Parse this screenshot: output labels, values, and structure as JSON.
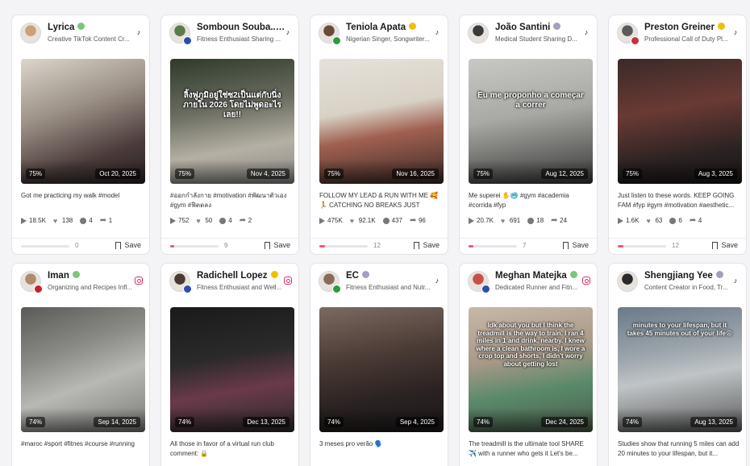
{
  "cards": [
    {
      "name": "Lyrica",
      "bio": "Creative TikTok Content Cr...",
      "platform": "tiktok",
      "score": "75%",
      "date": "Oct 20, 2025",
      "caption": "Got me practicing my walk #model",
      "views": "18.5K",
      "likes": "138",
      "comments": "4",
      "shares": "1",
      "count": "0",
      "save": "Save",
      "progress": 0,
      "overlay": "",
      "avatar_color": "#c9a27a",
      "flag_color": "",
      "badge_color": "#7bc67b",
      "thumb_bg": "linear-gradient(160deg,#dcd6cc 0%,#9a8f84 40%,#4a3a3a 75%,#2a2424 100%)"
    },
    {
      "name": "Somboun Souba...",
      "bio": "Fitness Enthusiast Sharing ...",
      "platform": "tiktok",
      "score": "75%",
      "date": "Nov 4, 2025",
      "caption": "#ออกกำลังกาย #motivation #พัฒนาตัวเอง #gym #ฟิตตลง",
      "views": "752",
      "likes": "50",
      "comments": "4",
      "shares": "2",
      "count": "9",
      "save": "Save",
      "progress": 0.08,
      "overlay": "ลิ้งฟูภูมิอยู่ใช่ซ2เป็นแต่กับนิ่ง ภายใน 2026 โดยไม่พูดอะไรเลย!!",
      "avatar_color": "#5c7a4a",
      "flag_color": "#2a4db0",
      "badge_color": "#a0a0c0",
      "thumb_bg": "linear-gradient(170deg,#2f3a2a 0%,#6a6d60 40%,#b5b0a4 70%,#8a8a88 100%)"
    },
    {
      "name": "Teniola Apata",
      "bio": "Nigerian Singer, Songwriter...",
      "platform": "tiktok",
      "score": "75%",
      "date": "Nov 16, 2025",
      "caption": "FOLLOW MY LEAD & RUN WITH ME 🥰 🏃 CATCHING NO BREAKS JUST SPEE...",
      "views": "475K",
      "likes": "92.1K",
      "comments": "437",
      "shares": "96",
      "count": "12",
      "save": "Save",
      "progress": 0.12,
      "overlay": "",
      "avatar_color": "#6a4a3a",
      "flag_color": "#2f9a3a",
      "badge_color": "#f0c000",
      "thumb_bg": "linear-gradient(170deg,#e6e2da 0%,#d8d2c6 40%,#a06050 60%,#3a2a26 100%)"
    },
    {
      "name": "João Santini",
      "bio": "Medical Student Sharing D...",
      "platform": "tiktok",
      "score": "75%",
      "date": "Aug 12, 2025",
      "caption": "Me superei ✋🥶 #gym #academia #corrida #fyp",
      "views": "20.7K",
      "likes": "691",
      "comments": "18",
      "shares": "24",
      "count": "7",
      "save": "Save",
      "progress": 0.1,
      "overlay": "Eu me proponho a começar a correr",
      "avatar_color": "#3a3a3a",
      "flag_color": "",
      "badge_color": "#a0a0c0",
      "thumb_bg": "linear-gradient(170deg,#c8c8c4 0%,#a8a8a4 45%,#6a6a68 75%,#3a3a3a 100%)"
    },
    {
      "name": "Preston Greiner",
      "bio": "Professional Call of Duty Pl...",
      "platform": "tiktok",
      "score": "75%",
      "date": "Aug 3, 2025",
      "caption": "Just listen to these words. KEEP GOING FAM #fyp #gym #motivation #aesthetic...",
      "views": "1.6K",
      "likes": "63",
      "comments": "6",
      "shares": "4",
      "count": "12",
      "save": "Save",
      "progress": 0.12,
      "overlay": "",
      "avatar_color": "#5a5a5a",
      "flag_color": "#c8323a",
      "badge_color": "#f0c000",
      "thumb_bg": "linear-gradient(170deg,#3a2a28 0%,#6a3a34 40%,#2a2222 75%,#1a1616 100%)"
    },
    {
      "name": "Iman",
      "bio": "Organizing and Recipes Infl...",
      "platform": "instagram",
      "score": "74%",
      "date": "Sep 14, 2025",
      "caption": "#maroc #sport #fitnes #course #running",
      "overlay": "",
      "avatar_color": "#b08a6a",
      "flag_color": "#c8202a",
      "badge_color": "#7bc67b",
      "thumb_bg": "linear-gradient(160deg,#5a5a58 0%,#8a8a86 35%,#b8b8b4 60%,#7a7a78 100%)"
    },
    {
      "name": "Radichell Lopez",
      "bio": "Fitness Enthusiast and Well...",
      "platform": "instagram",
      "score": "74%",
      "date": "Dec 13, 2025",
      "caption": "All those in favor of a virtual run club comment: 🔒",
      "overlay": "",
      "avatar_color": "#4a3a34",
      "flag_color": "#2a4db0",
      "badge_color": "#f0c000",
      "thumb_bg": "linear-gradient(170deg,#1a1a1a 0%,#2a2a2a 40%,#6a3a4a 65%,#2a2a2a 100%)"
    },
    {
      "name": "EC",
      "bio": "Fitness Enthusiast and Nutr...",
      "platform": "tiktok",
      "score": "74%",
      "date": "Sep 4, 2025",
      "caption": "3 meses pro verão 🗣️",
      "overlay": "",
      "avatar_color": "#8a6a5a",
      "flag_color": "#2f9a3a",
      "badge_color": "#a0a0c0",
      "thumb_bg": "linear-gradient(170deg,#7a6a60 0%,#4a3a34 40%,#2a2222 70%,#1a1818 100%)"
    },
    {
      "name": "Meghan Matejka",
      "bio": "Dedicated Runner and Fitn...",
      "platform": "instagram",
      "score": "74%",
      "date": "Dec 24, 2025",
      "caption": "The treadmill is the ultimate tool SHARE ✈️ with a runner who gets it Let's be...",
      "overlay": "Idk about you but I think the treadmill is the way to train. I ran 4 miles in 1 and drink, nearby. I knew where a clean bathroom is, I wore a crop top and shorts, I didn't worry about getting lost",
      "avatar_color": "#c8504a",
      "flag_color": "#2a4db0",
      "badge_color": "#7bc67b",
      "thumb_bg": "linear-gradient(170deg,#c8b8a8 0%,#a89888 40%,#5a8a6a 65%,#4a5a4a 100%)"
    },
    {
      "name": "Shengjiang Yee",
      "bio": "Content Creator in Food, Tr...",
      "platform": "tiktok",
      "score": "74%",
      "date": "Aug 13, 2025",
      "caption": "Studies show that running 5 miles can add 20 minutes to your lifespan, but it...",
      "overlay": "minutes to your lifespan, but it takes 45 minutes out of your life😩",
      "avatar_color": "#2a2a2a",
      "flag_color": "",
      "badge_color": "#a0a0c0",
      "thumb_bg": "linear-gradient(170deg,#6a7a8a 0%,#9aa4aa 35%,#c0c4c6 55%,#5a5a5a 100%)"
    }
  ]
}
